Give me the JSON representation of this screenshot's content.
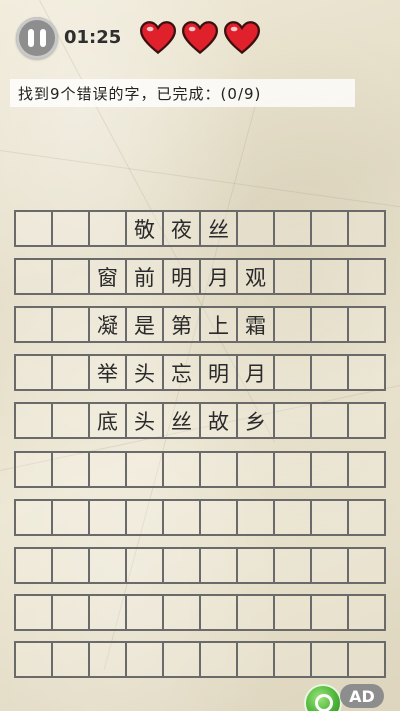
{
  "header": {
    "timer": "01:25",
    "lives": 3,
    "heart_color": "#e0202a"
  },
  "instruction": "找到9个错误的字，已完成：(0/9)",
  "grid": {
    "rows": [
      [
        "",
        "",
        "",
        "敬",
        "夜",
        "丝",
        "",
        "",
        "",
        ""
      ],
      [
        "",
        "",
        "窗",
        "前",
        "明",
        "月",
        "观",
        "",
        "",
        ""
      ],
      [
        "",
        "",
        "凝",
        "是",
        "第",
        "上",
        "霜",
        "",
        "",
        ""
      ],
      [
        "",
        "",
        "举",
        "头",
        "忘",
        "明",
        "月",
        "",
        "",
        ""
      ],
      [
        "",
        "",
        "底",
        "头",
        "丝",
        "故",
        "乡",
        "",
        "",
        ""
      ],
      [
        "",
        "",
        "",
        "",
        "",
        "",
        "",
        "",
        "",
        ""
      ],
      [
        "",
        "",
        "",
        "",
        "",
        "",
        "",
        "",
        "",
        ""
      ],
      [
        "",
        "",
        "",
        "",
        "",
        "",
        "",
        "",
        "",
        ""
      ],
      [
        "",
        "",
        "",
        "",
        "",
        "",
        "",
        "",
        "",
        ""
      ],
      [
        "",
        "",
        "",
        "",
        "",
        "",
        "",
        "",
        "",
        ""
      ]
    ]
  },
  "footer": {
    "ad_label": "AD"
  }
}
